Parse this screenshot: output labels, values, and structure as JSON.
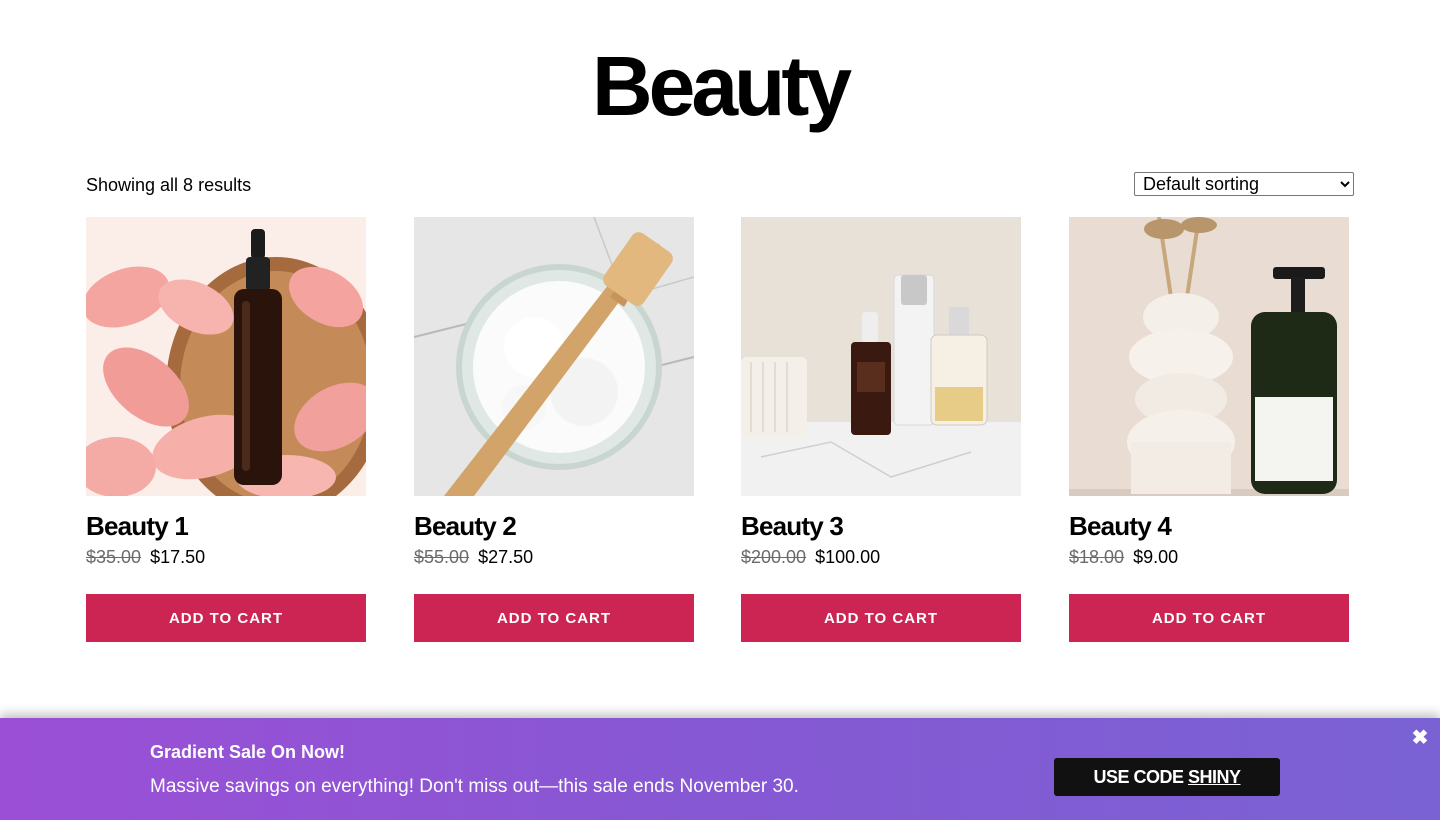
{
  "page": {
    "title": "Beauty",
    "results_count": "Showing all 8 results",
    "sort": {
      "selected": "Default sorting"
    }
  },
  "products": [
    {
      "name": "Beauty 1",
      "old_price": "$35.00",
      "price": "$17.50",
      "button": "Add to cart"
    },
    {
      "name": "Beauty 2",
      "old_price": "$55.00",
      "price": "$27.50",
      "button": "Add to cart"
    },
    {
      "name": "Beauty 3",
      "old_price": "$200.00",
      "price": "$100.00",
      "button": "Add to cart"
    },
    {
      "name": "Beauty 4",
      "old_price": "$18.00",
      "price": "$9.00",
      "button": "Add to cart"
    }
  ],
  "banner": {
    "heading": "Gradient Sale On Now!",
    "text": "Massive savings on everything! Don't miss out—this sale ends November 30.",
    "coupon_prefix": "USE CODE ",
    "coupon_code": "SHINY",
    "close_icon": "close-icon"
  },
  "colors": {
    "button": "#cc2553",
    "banner_start": "#9b4fd6",
    "banner_end": "#7a62d4",
    "coupon_button": "#111111"
  }
}
